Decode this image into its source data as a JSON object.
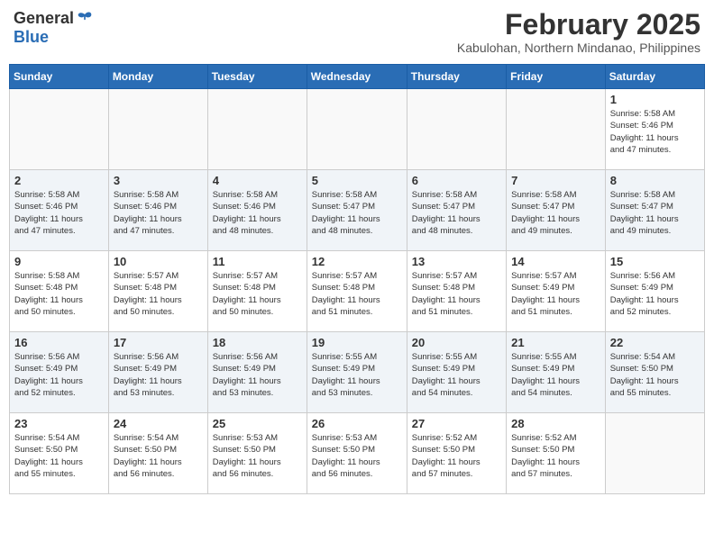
{
  "header": {
    "logo_general": "General",
    "logo_blue": "Blue",
    "month": "February 2025",
    "location": "Kabulohan, Northern Mindanao, Philippines"
  },
  "days_of_week": [
    "Sunday",
    "Monday",
    "Tuesday",
    "Wednesday",
    "Thursday",
    "Friday",
    "Saturday"
  ],
  "weeks": [
    [
      {
        "day": "",
        "info": ""
      },
      {
        "day": "",
        "info": ""
      },
      {
        "day": "",
        "info": ""
      },
      {
        "day": "",
        "info": ""
      },
      {
        "day": "",
        "info": ""
      },
      {
        "day": "",
        "info": ""
      },
      {
        "day": "1",
        "info": "Sunrise: 5:58 AM\nSunset: 5:46 PM\nDaylight: 11 hours\nand 47 minutes."
      }
    ],
    [
      {
        "day": "2",
        "info": "Sunrise: 5:58 AM\nSunset: 5:46 PM\nDaylight: 11 hours\nand 47 minutes."
      },
      {
        "day": "3",
        "info": "Sunrise: 5:58 AM\nSunset: 5:46 PM\nDaylight: 11 hours\nand 47 minutes."
      },
      {
        "day": "4",
        "info": "Sunrise: 5:58 AM\nSunset: 5:46 PM\nDaylight: 11 hours\nand 48 minutes."
      },
      {
        "day": "5",
        "info": "Sunrise: 5:58 AM\nSunset: 5:47 PM\nDaylight: 11 hours\nand 48 minutes."
      },
      {
        "day": "6",
        "info": "Sunrise: 5:58 AM\nSunset: 5:47 PM\nDaylight: 11 hours\nand 48 minutes."
      },
      {
        "day": "7",
        "info": "Sunrise: 5:58 AM\nSunset: 5:47 PM\nDaylight: 11 hours\nand 49 minutes."
      },
      {
        "day": "8",
        "info": "Sunrise: 5:58 AM\nSunset: 5:47 PM\nDaylight: 11 hours\nand 49 minutes."
      }
    ],
    [
      {
        "day": "9",
        "info": "Sunrise: 5:58 AM\nSunset: 5:48 PM\nDaylight: 11 hours\nand 50 minutes."
      },
      {
        "day": "10",
        "info": "Sunrise: 5:57 AM\nSunset: 5:48 PM\nDaylight: 11 hours\nand 50 minutes."
      },
      {
        "day": "11",
        "info": "Sunrise: 5:57 AM\nSunset: 5:48 PM\nDaylight: 11 hours\nand 50 minutes."
      },
      {
        "day": "12",
        "info": "Sunrise: 5:57 AM\nSunset: 5:48 PM\nDaylight: 11 hours\nand 51 minutes."
      },
      {
        "day": "13",
        "info": "Sunrise: 5:57 AM\nSunset: 5:48 PM\nDaylight: 11 hours\nand 51 minutes."
      },
      {
        "day": "14",
        "info": "Sunrise: 5:57 AM\nSunset: 5:49 PM\nDaylight: 11 hours\nand 51 minutes."
      },
      {
        "day": "15",
        "info": "Sunrise: 5:56 AM\nSunset: 5:49 PM\nDaylight: 11 hours\nand 52 minutes."
      }
    ],
    [
      {
        "day": "16",
        "info": "Sunrise: 5:56 AM\nSunset: 5:49 PM\nDaylight: 11 hours\nand 52 minutes."
      },
      {
        "day": "17",
        "info": "Sunrise: 5:56 AM\nSunset: 5:49 PM\nDaylight: 11 hours\nand 53 minutes."
      },
      {
        "day": "18",
        "info": "Sunrise: 5:56 AM\nSunset: 5:49 PM\nDaylight: 11 hours\nand 53 minutes."
      },
      {
        "day": "19",
        "info": "Sunrise: 5:55 AM\nSunset: 5:49 PM\nDaylight: 11 hours\nand 53 minutes."
      },
      {
        "day": "20",
        "info": "Sunrise: 5:55 AM\nSunset: 5:49 PM\nDaylight: 11 hours\nand 54 minutes."
      },
      {
        "day": "21",
        "info": "Sunrise: 5:55 AM\nSunset: 5:49 PM\nDaylight: 11 hours\nand 54 minutes."
      },
      {
        "day": "22",
        "info": "Sunrise: 5:54 AM\nSunset: 5:50 PM\nDaylight: 11 hours\nand 55 minutes."
      }
    ],
    [
      {
        "day": "23",
        "info": "Sunrise: 5:54 AM\nSunset: 5:50 PM\nDaylight: 11 hours\nand 55 minutes."
      },
      {
        "day": "24",
        "info": "Sunrise: 5:54 AM\nSunset: 5:50 PM\nDaylight: 11 hours\nand 56 minutes."
      },
      {
        "day": "25",
        "info": "Sunrise: 5:53 AM\nSunset: 5:50 PM\nDaylight: 11 hours\nand 56 minutes."
      },
      {
        "day": "26",
        "info": "Sunrise: 5:53 AM\nSunset: 5:50 PM\nDaylight: 11 hours\nand 56 minutes."
      },
      {
        "day": "27",
        "info": "Sunrise: 5:52 AM\nSunset: 5:50 PM\nDaylight: 11 hours\nand 57 minutes."
      },
      {
        "day": "28",
        "info": "Sunrise: 5:52 AM\nSunset: 5:50 PM\nDaylight: 11 hours\nand 57 minutes."
      },
      {
        "day": "",
        "info": ""
      }
    ]
  ]
}
